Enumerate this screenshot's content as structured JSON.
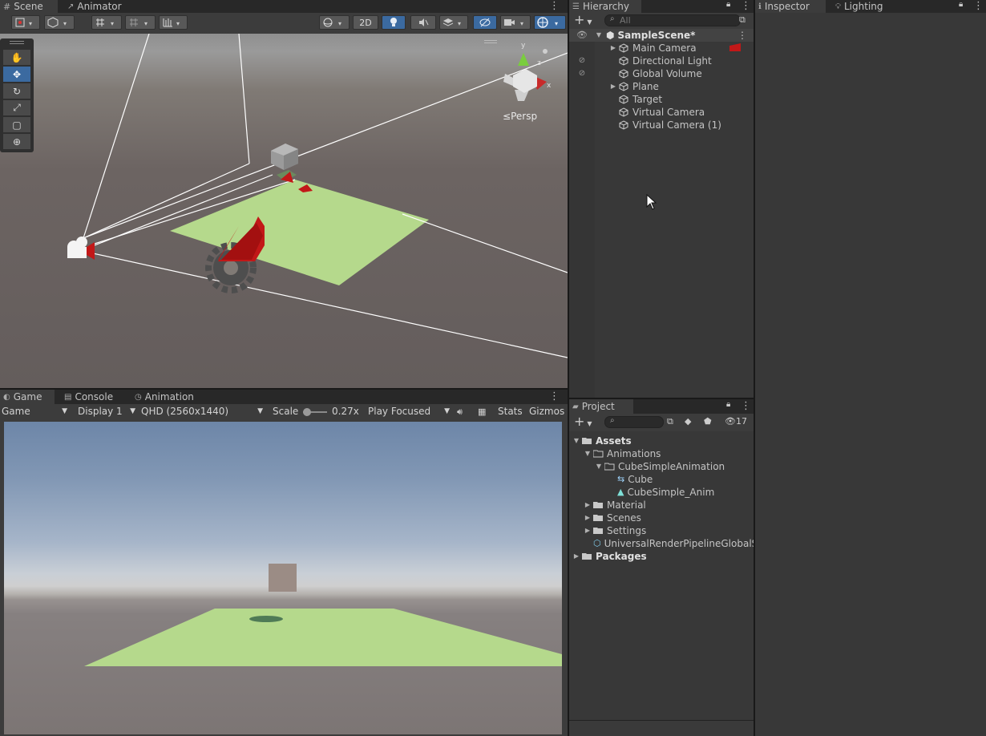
{
  "scene_panel": {
    "tabs": [
      {
        "label": "Scene"
      },
      {
        "label": "Animator"
      }
    ],
    "mode_2d_label": "2D",
    "persp_label": "Persp",
    "gizmo_axes": {
      "y": "y",
      "x": "x",
      "z": "z"
    }
  },
  "game_panel": {
    "tabs": [
      {
        "label": "Game"
      },
      {
        "label": "Console"
      },
      {
        "label": "Animation"
      }
    ],
    "view_select": "Game",
    "display_select": "Display 1",
    "resolution_select": "QHD (2560x1440)",
    "scale_label": "Scale",
    "scale_value": "0.27x",
    "play_focus_select": "Play Focused",
    "stats_label": "Stats",
    "gizmos_label": "Gizmos"
  },
  "hierarchy": {
    "tab_label": "Hierarchy",
    "search_placeholder": "All",
    "scene_name": "SampleScene*",
    "items": [
      {
        "label": "Main Camera"
      },
      {
        "label": "Directional Light"
      },
      {
        "label": "Global Volume"
      },
      {
        "label": "Plane"
      },
      {
        "label": "Target"
      },
      {
        "label": "Virtual Camera"
      },
      {
        "label": "Virtual Camera (1)"
      }
    ]
  },
  "inspector": {
    "tabs": [
      {
        "label": "Inspector"
      },
      {
        "label": "Lighting"
      }
    ]
  },
  "project": {
    "tab_label": "Project",
    "hidden_count": "17",
    "tree": [
      {
        "label": "Assets"
      },
      {
        "label": "Animations"
      },
      {
        "label": "CubeSimpleAnimation"
      },
      {
        "label": "Cube"
      },
      {
        "label": "CubeSimple_Anim"
      },
      {
        "label": "Material"
      },
      {
        "label": "Scenes"
      },
      {
        "label": "Settings"
      },
      {
        "label": "UniversalRenderPipelineGlobalSettings"
      },
      {
        "label": "Packages"
      }
    ]
  },
  "colors": {
    "accent": "#3b6aa0",
    "plane_green": "#b5d98c",
    "camera_red": "#c21818"
  }
}
